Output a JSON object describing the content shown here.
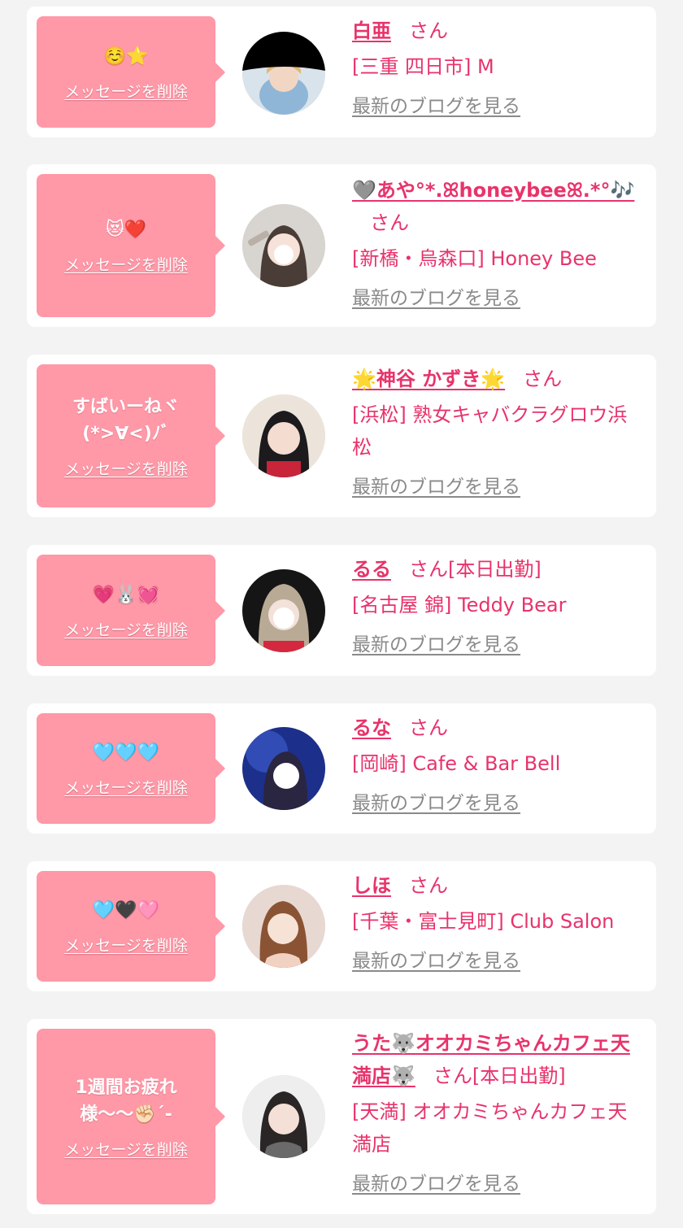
{
  "delete_label": "メッセージを削除",
  "blog_label": "最新のブログを見る",
  "san": "さん",
  "colors": {
    "accent": "#e8336b",
    "bubble": "#ff98a7",
    "link_gray": "#8a8a8a",
    "background": "#f3f3f3"
  },
  "items": [
    {
      "message": "☺️⭐",
      "name": "白亜",
      "tag": "",
      "shop": "[三重 四日市] M",
      "avatar_icon": "cast-photo"
    },
    {
      "message": "😻❤️",
      "name": "🩶あや°*.ꕤhoneybeeꕤ.*°🎶",
      "tag": "",
      "shop": "[新橋・烏森口] Honey Bee",
      "avatar_icon": "cast-photo"
    },
    {
      "message": "すばいーねヾ\n(*>∀<)ﾉﾞ",
      "name": "🌟神谷 かずき🌟",
      "tag": "",
      "shop": "[浜松] 熟女キャバクラグロウ浜松",
      "avatar_icon": "cast-photo"
    },
    {
      "message": "💗🐰💓",
      "name": "るる",
      "tag": "[本日出勤]",
      "shop": "[名古屋 錦] Teddy Bear",
      "avatar_icon": "cast-photo"
    },
    {
      "message": "🩵🩵🩵",
      "name": "るな",
      "tag": "",
      "shop": "[岡崎] Cafe & Bar Bell",
      "avatar_icon": "cast-photo"
    },
    {
      "message": "🩵🖤🩷",
      "name": "しほ",
      "tag": "",
      "shop": "[千葉・富士見町] Club Salon",
      "avatar_icon": "cast-photo"
    },
    {
      "message": "1週間お疲れ\n様〜〜✊🏻´-",
      "name": "うた🐺オオカミちゃんカフェ天満店🐺",
      "tag": "[本日出勤]",
      "shop": "[天満] オオカミちゃんカフェ天満店",
      "avatar_icon": "cast-photo"
    }
  ]
}
